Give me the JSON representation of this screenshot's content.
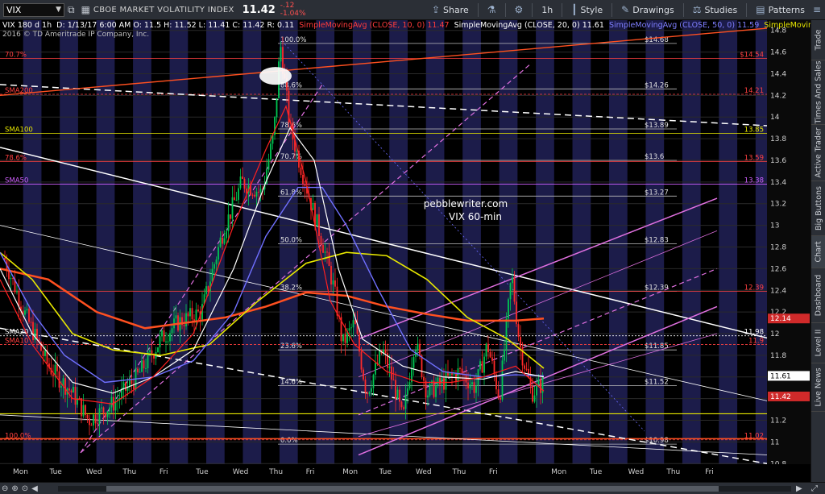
{
  "toolbar": {
    "symbol": "VIX",
    "description": "CBOE MARKET VOLATILITY INDEX",
    "last": "11.42",
    "change": "-.12",
    "change_pct": "-1.04%",
    "share": "Share",
    "interval": "1h",
    "style": "Style",
    "drawings": "Drawings",
    "studies": "Studies",
    "patterns": "Patterns"
  },
  "info": {
    "header": "VIX 180 d 1h",
    "fields": "D: 1/13/17 6:00 AM  O: 11.5  H: 11.52  L: 11.41  C: 11.42  R: 0.11",
    "sma10": "SimpleMovingAvg (CLOSE, 10, 0) 11.47",
    "sma20": "SimpleMovingAvg (CLOSE, 20, 0) 11.61",
    "sma50": "SimpleMovingAvg (CLOSE, 50, 0) 11.59",
    "sma_more": "SimpleMoving...",
    "copyright": "2016 © TD Ameritrade IP Company, Inc."
  },
  "chart_data": {
    "type": "candlestick",
    "title": "",
    "watermark": [
      "pebblewriter.com",
      "VIX 60-min"
    ],
    "x_ticks": [
      "Mon",
      "Tue",
      "Wed",
      "Thu",
      "Fri",
      "Tue",
      "Wed",
      "Thu",
      "Fri",
      "Mon",
      "Tue",
      "Wed",
      "Thu",
      "Fri",
      "Mon",
      "Tue",
      "Wed",
      "Thu",
      "Fri"
    ],
    "y_ticks": [
      14.8,
      14.6,
      14.4,
      14.2,
      14,
      13.8,
      13.6,
      13.4,
      13.2,
      13,
      12.8,
      12.6,
      12.4,
      12.2,
      12,
      11.8,
      11.6,
      11.4,
      11.2,
      11,
      10.8
    ],
    "ylim": [
      10.75,
      14.85
    ],
    "fib_levels": [
      {
        "pct": "100.0%",
        "value": "$14.68"
      },
      {
        "pct": "88.6%",
        "value": "$14.26"
      },
      {
        "pct": "78.6%",
        "value": "$13.89"
      },
      {
        "pct": "70.7%",
        "value": "$13.6"
      },
      {
        "pct": "61.8%",
        "value": "$13.27"
      },
      {
        "pct": "50.0%",
        "value": "$12.83"
      },
      {
        "pct": "38.2%",
        "value": "$12.39"
      },
      {
        "pct": "23.6%",
        "value": "$11.85"
      },
      {
        "pct": "14.6%",
        "value": "$11.52"
      },
      {
        "pct": "0.0%",
        "value": "$10.98"
      }
    ],
    "left_labels": [
      {
        "text": "70.7%",
        "y": 14.54,
        "color": "#ff4040"
      },
      {
        "text": "SMA200",
        "y": 14.21,
        "color": "#ff4040"
      },
      {
        "text": "SMA100",
        "y": 13.85,
        "color": "#e8e800"
      },
      {
        "text": "78.6%",
        "y": 13.59,
        "color": "#ff4040"
      },
      {
        "text": "SMA50",
        "y": 13.38,
        "color": "#d060ff"
      },
      {
        "text": "SMA20",
        "y": 11.98,
        "color": "#ffffff"
      },
      {
        "text": "SMA10",
        "y": 11.9,
        "color": "#ff4040"
      },
      {
        "text": "100.0%",
        "y": 11.02,
        "color": "#ff4040"
      }
    ],
    "right_labels": [
      {
        "text": "$14.54",
        "y": 14.54,
        "color": "#ff4040"
      },
      {
        "text": "14.21",
        "y": 14.21,
        "color": "#ff4040"
      },
      {
        "text": "13.85",
        "y": 13.85,
        "color": "#e8e800"
      },
      {
        "text": "13.59",
        "y": 13.59,
        "color": "#ff4040"
      },
      {
        "text": "13.38",
        "y": 13.38,
        "color": "#d060ff"
      },
      {
        "text": "12.39",
        "y": 12.39,
        "color": "#ff4040"
      },
      {
        "text": "11.98",
        "y": 11.98,
        "color": "#ffffff"
      },
      {
        "text": "11.9",
        "y": 11.9,
        "color": "#ff4040"
      },
      {
        "text": "11.02",
        "y": 11.02,
        "color": "#ff4040"
      }
    ],
    "price_tags": [
      {
        "text": "12.14",
        "y": 12.14,
        "bg": "#d02a2a",
        "fg": "#ffffff"
      },
      {
        "text": "11.61",
        "y": 11.61,
        "bg": "#ffffff",
        "fg": "#000000"
      },
      {
        "text": "11.42",
        "y": 11.42,
        "bg": "#d02a2a",
        "fg": "#ffffff"
      }
    ]
  },
  "rail": {
    "tabs": [
      "Trade",
      "Times And Sales",
      "Active Trader",
      "Big Buttons",
      "Chart",
      "Dashboard",
      "Level II",
      "Live News"
    ]
  },
  "colors": {
    "up": "#00c853",
    "down": "#ff2a2a",
    "bg_stripe": "#1c1c4a",
    "sma20": "#ffffff",
    "sma50": "#7070ff",
    "sma100": "#e8e800",
    "sma200": "#ff5020",
    "channel": "#e070e0"
  }
}
